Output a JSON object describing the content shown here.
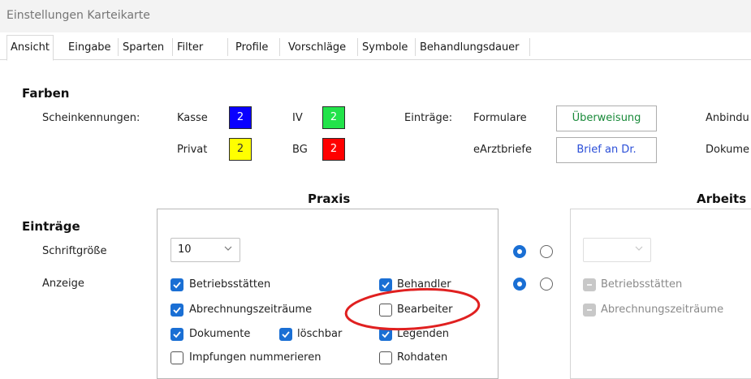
{
  "window": {
    "title": "Einstellungen Karteikarte"
  },
  "tabs": [
    "Ansicht",
    "Eingabe",
    "Sparten",
    "Filter",
    "Profile",
    "Vorschläge",
    "Symbole",
    "Behandlungsdauer"
  ],
  "farben": {
    "heading": "Farben",
    "scheinkennungen_label": "Scheinkennungen:",
    "kasse": {
      "label": "Kasse",
      "value": "2",
      "color": "#0a00ff"
    },
    "iv": {
      "label": "IV",
      "value": "2",
      "color": "#22e34a"
    },
    "privat": {
      "label": "Privat",
      "value": "2",
      "color": "#ffff00"
    },
    "bg": {
      "label": "BG",
      "value": "2",
      "color": "#ff0000"
    },
    "eintraege_label": "Einträge:",
    "formulare": {
      "label": "Formulare",
      "button": "Überweisung",
      "color": "#1a8a3a"
    },
    "earztbriefe": {
      "label": "eArztbriefe",
      "button": "Brief an Dr.",
      "color": "#2b4fd8"
    },
    "anbindung_label": "Anbindu",
    "dokumente_label": "Dokume"
  },
  "praxis": {
    "header": "Praxis"
  },
  "arbeits": {
    "header": "Arbeits"
  },
  "eintraege": {
    "heading": "Einträge",
    "schriftgroesse_label": "Schriftgröße",
    "schriftgroesse_value": "10",
    "anzeige_label": "Anzeige",
    "checks": {
      "betriebsstaetten": {
        "label": "Betriebsstätten",
        "checked": true
      },
      "behandler": {
        "label": "Behandler",
        "checked": true
      },
      "abrechnungszeitraeume": {
        "label": "Abrechnungszeiträume",
        "checked": true
      },
      "bearbeiter": {
        "label": "Bearbeiter",
        "checked": false
      },
      "dokumente": {
        "label": "Dokumente",
        "checked": true
      },
      "loeschbar": {
        "label": "löschbar",
        "checked": true
      },
      "legenden": {
        "label": "Legenden",
        "checked": true
      },
      "impfungen": {
        "label": "Impfungen nummerieren",
        "checked": false
      },
      "rohdaten": {
        "label": "Rohdaten",
        "checked": false
      }
    },
    "arbeits_checks": {
      "betriebsstaetten": {
        "label": "Betriebsstätten"
      },
      "abrechnungszeitraeume": {
        "label": "Abrechnungszeiträume"
      }
    }
  },
  "annotation": {
    "color": "#e02020"
  }
}
